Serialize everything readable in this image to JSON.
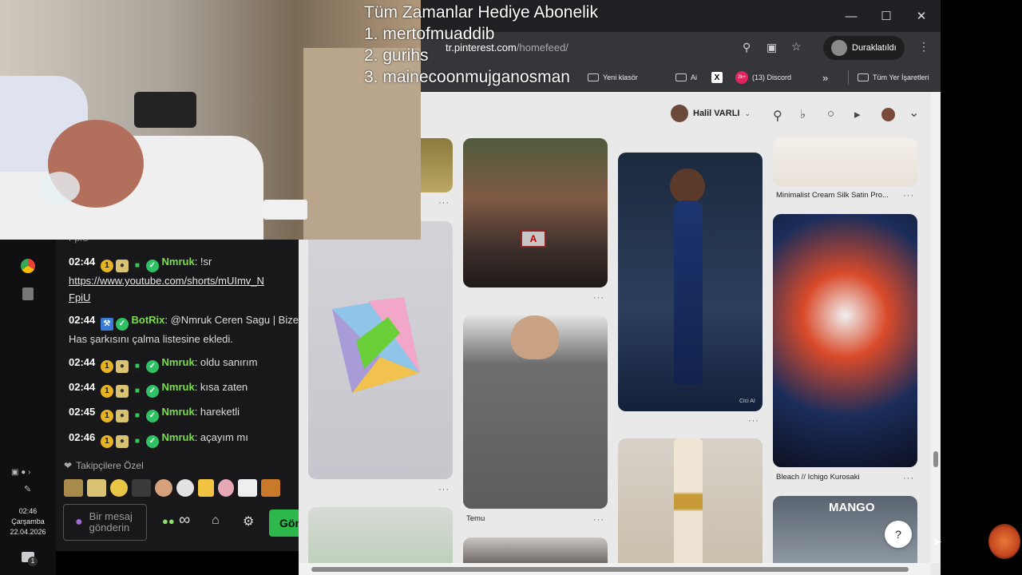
{
  "overlay": {
    "title": "Tüm Zamanlar Hediye  Abonelik",
    "rank1": "1. mertofmuaddib",
    "rank2": "2. gurihs",
    "rank3": "3. mainecoonmujganosman"
  },
  "browser": {
    "url_host": "tr.pinterest.com",
    "url_path": "/homefeed/",
    "profile_label": "Duraklatıldı",
    "bookmarks": {
      "folder1": "Yeni klasör",
      "folder2": "Ai",
      "discord": "(13) Discord",
      "all_bookmarks": "Tüm Yer İşaretleri",
      "discord_badge": "2k+"
    }
  },
  "pinterest": {
    "user_name": "Halil VARLI",
    "captions": {
      "minimalist": "Minimalist Cream Silk Satin Pro...",
      "bleach": "Bleach // Ichigo Kurosaki",
      "temu": "Temu",
      "cici": "Cici AI"
    },
    "help": "?"
  },
  "chat": {
    "prev_link_tail": "FpiU",
    "lines": [
      {
        "time": "02:44",
        "user": "Nmruk",
        "text": ": !sr"
      },
      {
        "time": "02:44",
        "user": "BotRix",
        "text": ": @Nmruk Ceren Sagu | Bize Has şarkısını çalma listesine ekledi."
      },
      {
        "time": "02:44",
        "user": "Nmruk",
        "text": ": oldu sanırım"
      },
      {
        "time": "02:44",
        "user": "Nmruk",
        "text": ": kısa zaten"
      },
      {
        "time": "02:45",
        "user": "Nmruk",
        "text": ": hareketli"
      },
      {
        "time": "02:46",
        "user": "Nmruk",
        "text": ": açayım mı"
      }
    ],
    "link_line1": "https://www.youtube.com/shorts/mUImv_N",
    "link_line2": "FpiU",
    "badge_sub": "1",
    "followers_only": "Takipçilere Özel",
    "input_placeholder": "Bir mesaj gönderin",
    "send_label": "Gön",
    "infinity": "∞"
  },
  "taskbar": {
    "time": "02:46",
    "day": "Çarşamba",
    "date": "22.04.2026",
    "notif_count": "1"
  },
  "colors": {
    "pinterest_bg": "#e9e9ea",
    "chat_bg": "#18181b",
    "username_green": "#7ddc4b",
    "send_green": "#2db84c"
  }
}
